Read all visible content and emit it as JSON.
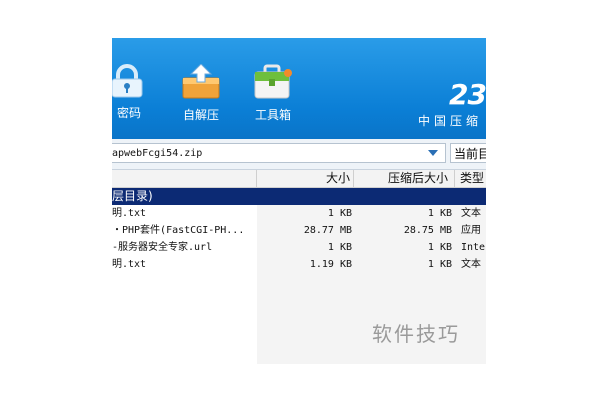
{
  "toolbar": {
    "buttons": [
      {
        "label": "密码",
        "icon": "lock-icon"
      },
      {
        "label": "自解压",
        "icon": "self-extract-icon"
      },
      {
        "label": "工具箱",
        "icon": "toolbox-icon"
      }
    ],
    "brand_number": "23",
    "brand_slogan": "中国压缩"
  },
  "address_bar": {
    "path": "apwebFcgi54.zip",
    "current_dir_label": "当前目"
  },
  "file_list": {
    "columns": [
      "大小",
      "压缩后大小",
      "类型"
    ],
    "up_row": "层目录)",
    "rows": [
      {
        "name": "明.txt",
        "size": "1 KB",
        "compressed": "1 KB",
        "type": "文本"
      },
      {
        "name": "・PHP套件(FastCGI-PH...",
        "size": "28.77 MB",
        "compressed": "28.75 MB",
        "type": "应用"
      },
      {
        "name": "-服务器安全专家.url",
        "size": "1 KB",
        "compressed": "1 KB",
        "type": "Inte"
      },
      {
        "name": "明.txt",
        "size": "1.19 KB",
        "compressed": "1 KB",
        "type": "文本"
      }
    ]
  },
  "watermark": "软件技巧",
  "colors": {
    "toolbar_blue": "#0b7fd6",
    "selection_navy": "#0c2a74"
  }
}
